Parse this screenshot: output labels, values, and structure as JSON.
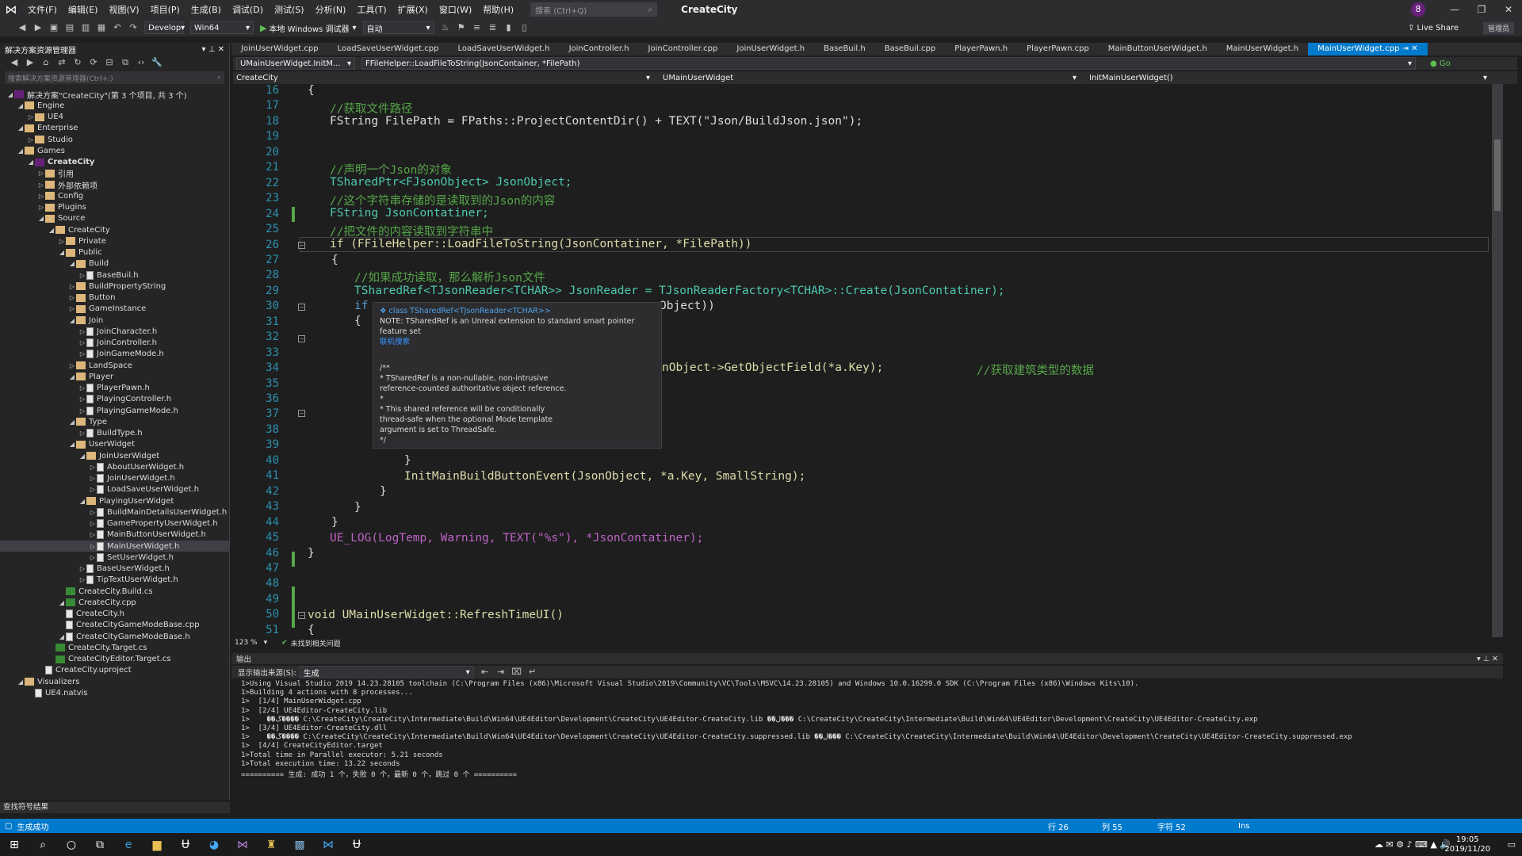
{
  "titlebar": {
    "menus": [
      "文件(F)",
      "编辑(E)",
      "视图(V)",
      "项目(P)",
      "生成(B)",
      "调试(D)",
      "测试(S)",
      "分析(N)",
      "工具(T)",
      "扩展(X)",
      "窗口(W)",
      "帮助(H)"
    ],
    "search_placeholder": "搜索 (Ctrl+Q)",
    "app_title": "CreateCity",
    "notification_count": "8",
    "minimize": "—",
    "restore": "❐",
    "close": "✕"
  },
  "toolbar": {
    "config": "Develop",
    "platform": "Win64",
    "run_label": "本地 Windows 调试器",
    "run_mode": "自动",
    "live_share": "Live Share",
    "admin": "管理员"
  },
  "solution": {
    "title": "解决方案资源管理器",
    "search_placeholder": "搜索解决方案资源管理器(Ctrl+;)",
    "items": [
      "解决方案\"CreateCity\"(第 3 个项目, 共 3 个)",
      "Engine",
      "UE4",
      "Enterprise",
      "Studio",
      "Games",
      "CreateCity",
      "引用",
      "外部依赖项",
      "Config",
      "Plugins",
      "Source",
      "CreateCity",
      "Private",
      "Public",
      "Build",
      "BaseBuil.h",
      "BuildPropertyString",
      "Button",
      "GameInstance",
      "Join",
      "JoinCharacter.h",
      "JoinController.h",
      "JoinGameMode.h",
      "LandSpace",
      "Player",
      "PlayerPawn.h",
      "PlayingController.h",
      "PlayingGameMode.h",
      "Type",
      "BuildType.h",
      "UserWidget",
      "JoinUserWidget",
      "AboutUserWidget.h",
      "JoinUserWidget.h",
      "LoadSaveUserWidget.h",
      "PlayingUserWidget",
      "BuildMainDetailsUserWidget.h",
      "GamePropertyUserWidget.h",
      "MainButtonUserWidget.h",
      "MainUserWidget.h",
      "SetUserWidget.h",
      "BaseUserWidget.h",
      "TipTextUserWidget.h",
      "CreateCity.Build.cs",
      "CreateCity.cpp",
      "CreateCity.h",
      "CreateCityGameModeBase.cpp",
      "CreateCityGameModeBase.h",
      "CreateCity.Target.cs",
      "CreateCityEditor.Target.cs",
      "CreateCity.uproject",
      "Visualizers",
      "UE4.natvis"
    ]
  },
  "tabs": [
    "JoinUserWidget.cpp",
    "LoadSaveUserWidget.cpp",
    "LoadSaveUserWidget.h",
    "JoinController.h",
    "JoinController.cpp",
    "JoinUserWidget.h",
    "BaseBuil.h",
    "BaseBuil.cpp",
    "PlayerPawn.h",
    "PlayerPawn.cpp",
    "MainButtonUserWidget.h",
    "MainUserWidget.h",
    "MainUserWidget.cpp"
  ],
  "nav": {
    "file_scope": "UMainUserWidget.InitM...",
    "member": "FFileHelper::LoadFileToString(JsonContainer, *FilePath)",
    "go": "Go",
    "project": "CreateCity",
    "class": "UMainUserWidget",
    "method": "InitMainUserWidget()"
  },
  "code": {
    "line_numbers": [
      "16",
      "17",
      "18",
      "19",
      "20",
      "21",
      "22",
      "23",
      "24",
      "25",
      "26",
      "27",
      "28",
      "29",
      "30",
      "31",
      "32",
      "33",
      "34",
      "35",
      "36",
      "37",
      "38",
      "39",
      "40",
      "41",
      "42",
      "43",
      "44",
      "45",
      "46",
      "47",
      "48",
      "49",
      "50",
      "51"
    ],
    "l17": "//获取文件路径",
    "l18": "FString FilePath = FPaths::ProjectContentDir() + TEXT(\"Json/BuildJson.json\");",
    "l21": "//声明一个Json的对象",
    "l22": "TSharedPtr<FJsonObject> JsonObject;",
    "l23": "//这个字符串存储的是读取到的Json的内容",
    "l24": "FString JsonContatiner;",
    "l25": "//把文件的内容读取到字符串中",
    "l26": "if (FFileHelper::LoadFileToString(JsonContatiner, *FilePath))",
    "l28": "//如果成功读取，那么解析Json文件",
    "l29": "TSharedRef<TJsonReader<TCHAR>> JsonReader = TJsonReaderFactory<TCHAR>::Create(JsonContatiner);",
    "l30a": "if",
    "l30b": "Object))",
    "l34a": "nObject->GetObjectField(*a.Key);",
    "l34b": "//获取建筑类型的数据",
    "l41": "InitMainBuildButtonEvent(JsonObject, *a.Key, SmallString);",
    "l45": "UE_LOG(LogTemp, Warning, TEXT(\"%s\"), *JsonContatiner);",
    "l50": "void UMainUserWidget::RefreshTimeUI()"
  },
  "tooltip": {
    "head": "class TSharedRef<TJsonReader<TCHAR>>",
    "note": "NOTE: TSharedRef is an Unreal extension to standard smart pointer feature set",
    "link": "联机搜索",
    "lines": [
      "/**",
      " * TSharedRef is a non-nullable, non-intrusive",
      " reference-counted authoritative object reference.",
      " *",
      " * This shared reference will be conditionally",
      " thread-safe when the optional Mode template",
      " argument is set to ThreadSafe.",
      " */"
    ]
  },
  "editor_status": {
    "zoom": "123 %",
    "issues": "未找到相关问题"
  },
  "output": {
    "title": "输出",
    "source_label": "显示输出来源(S):",
    "source_value": "生成",
    "lines": [
      "1>Using Visual Studio 2019 14.23.28105 toolchain (C:\\Program Files (x86)\\Microsoft Visual Studio\\2019\\Community\\VC\\Tools\\MSVC\\14.23.28105) and Windows 10.0.16299.0 SDK (C:\\Program Files (x86)\\Windows Kits\\10).",
      "1>Building 4 actions with 8 processes...",
      "1>  [1/4] MainUserWidget.cpp",
      "1>  [2/4] UE4Editor-CreateCity.lib",
      "1>    ��ڴ���� C:\\CreateCity\\CreateCity\\Intermediate\\Build\\Win64\\UE4Editor\\Development\\CreateCity\\UE4Editor-CreateCity.lib ��ڶ��� C:\\CreateCity\\CreateCity\\Intermediate\\Build\\Win64\\UE4Editor\\Development\\CreateCity\\UE4Editor-CreateCity.exp",
      "1>  [3/4] UE4Editor-CreateCity.dll",
      "1>    ��ڴ���� C:\\CreateCity\\CreateCity\\Intermediate\\Build\\Win64\\UE4Editor\\Development\\CreateCity\\UE4Editor-CreateCity.suppressed.lib ��ڶ��� C:\\CreateCity\\CreateCity\\Intermediate\\Build\\Win64\\UE4Editor\\Development\\CreateCity\\UE4Editor-CreateCity.suppressed.exp",
      "1>  [4/4] CreateCityEditor.target",
      "1>Total time in Parallel executor: 5.21 seconds",
      "1>Total execution time: 13.22 seconds",
      "========== 生成: 成功 1 个，失败 0 个，最新 0 个，跳过 0 个 =========="
    ]
  },
  "find_results": "查找符号结果",
  "status": {
    "message": "生成成功",
    "line": "行 26",
    "col": "列 55",
    "char": "字符 52",
    "ins": "Ins"
  },
  "clock": {
    "time": "19:05",
    "date": "2019/11/20"
  }
}
